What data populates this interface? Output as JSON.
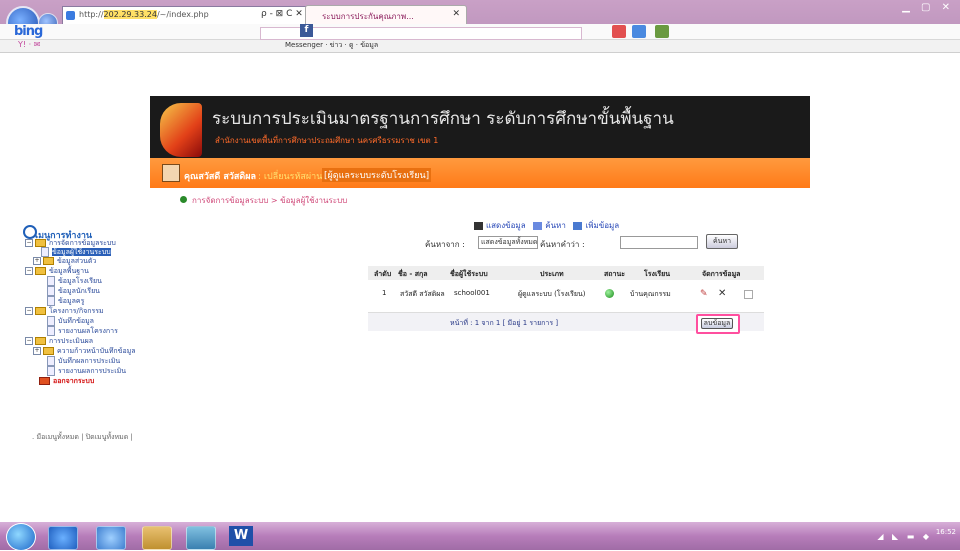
{
  "browser": {
    "address": "http://202.29.33.24/~/index.php",
    "address_highlight": "202.29.33.24",
    "address_controls": "ρ - ⊠ C ✕",
    "tab_title": "ระบบการประกันคุณภาพ...",
    "bing_label": "bing",
    "toolbar_left": "Y! · ✉",
    "toolbar_mid": "Messenger · ข่าว · ดู · ข้อมูล"
  },
  "header": {
    "title": "ระบบการประเมินมาตรฐานการศึกษา ระดับการศึกษาขั้นพื้นฐาน",
    "subtitle": "สำนักงานเขตพื้นที่การศึกษาประถมศึกษา นครศรีธรรมราช เขต 1"
  },
  "userbar": {
    "name": "คุณสวัสดี สวัสดิผล",
    "link": ": เปลี่ยนรหัสผ่าน",
    "role": "[ผู้ดูแลระบบระดับโรงเรียน]"
  },
  "breadcrumb": "การจัดการข้อมูลระบบ > ข้อมูลผู้ใช้งานระบบ",
  "sidebar": {
    "title": "เมนูการทำงาน",
    "items": [
      "การจัดการข้อมูลระบบ",
      "ข้อมูลผู้ใช้งานระบบ",
      "ข้อมูลส่วนตัว",
      "ข้อมูลพื้นฐาน",
      "ข้อมูลโรงเรียน",
      "ข้อมูลนักเรียน",
      "ข้อมูลครู",
      "โครงการ/กิจกรรม",
      "บันทึกข้อมูล",
      "รายงานผลโครงการ",
      "การประเมินผล",
      "ความก้าวหน้าบันทึกข้อมูล",
      "บันทึกผลการประเมิน",
      "รายงานผลการประเมิน",
      "ออกจากระบบ"
    ],
    "links": ". มือเมนูทั้งหมด  |  ปิดเมนูทั้งหมด  |"
  },
  "toolbar": {
    "show_all": "แสดงข้อมูล",
    "edit": "ค้นหา",
    "add": "เพิ่มข้อมูล"
  },
  "search": {
    "label": "ค้นหาจาก :",
    "select_value": "แสดงข้อมูลทั้งหมด",
    "label2": "ค้นหาคำว่า :",
    "button": "ค้นหา"
  },
  "table": {
    "headers": [
      "ลำดับ",
      "ชื่อ - สกุล",
      "ชื่อผู้ใช้ระบบ",
      "ประเภท",
      "สถานะ",
      "โรงเรียน",
      "จัดการข้อมูล"
    ],
    "rows": [
      [
        "1",
        "สวัสดี สวัสดิผล",
        "school001",
        "ผู้ดูแลระบบ (โรงเรียน)",
        "",
        "บ้านคุณกรรม"
      ]
    ],
    "pager": "หน้าที่ : 1 จาก 1    [ มีอยู่ 1 รายการ ]",
    "delete_button": "ลบข้อมูล"
  },
  "taskbar": {
    "word_label": "W",
    "tray": "◢ ◣ ▬ ◆",
    "clock": "16:52"
  },
  "colors": {
    "header_bg": "#1a1a1a",
    "orange_bar": "#ff8a26",
    "highlight_border": "#ff4f9f",
    "chrome": "#b88fb8"
  }
}
